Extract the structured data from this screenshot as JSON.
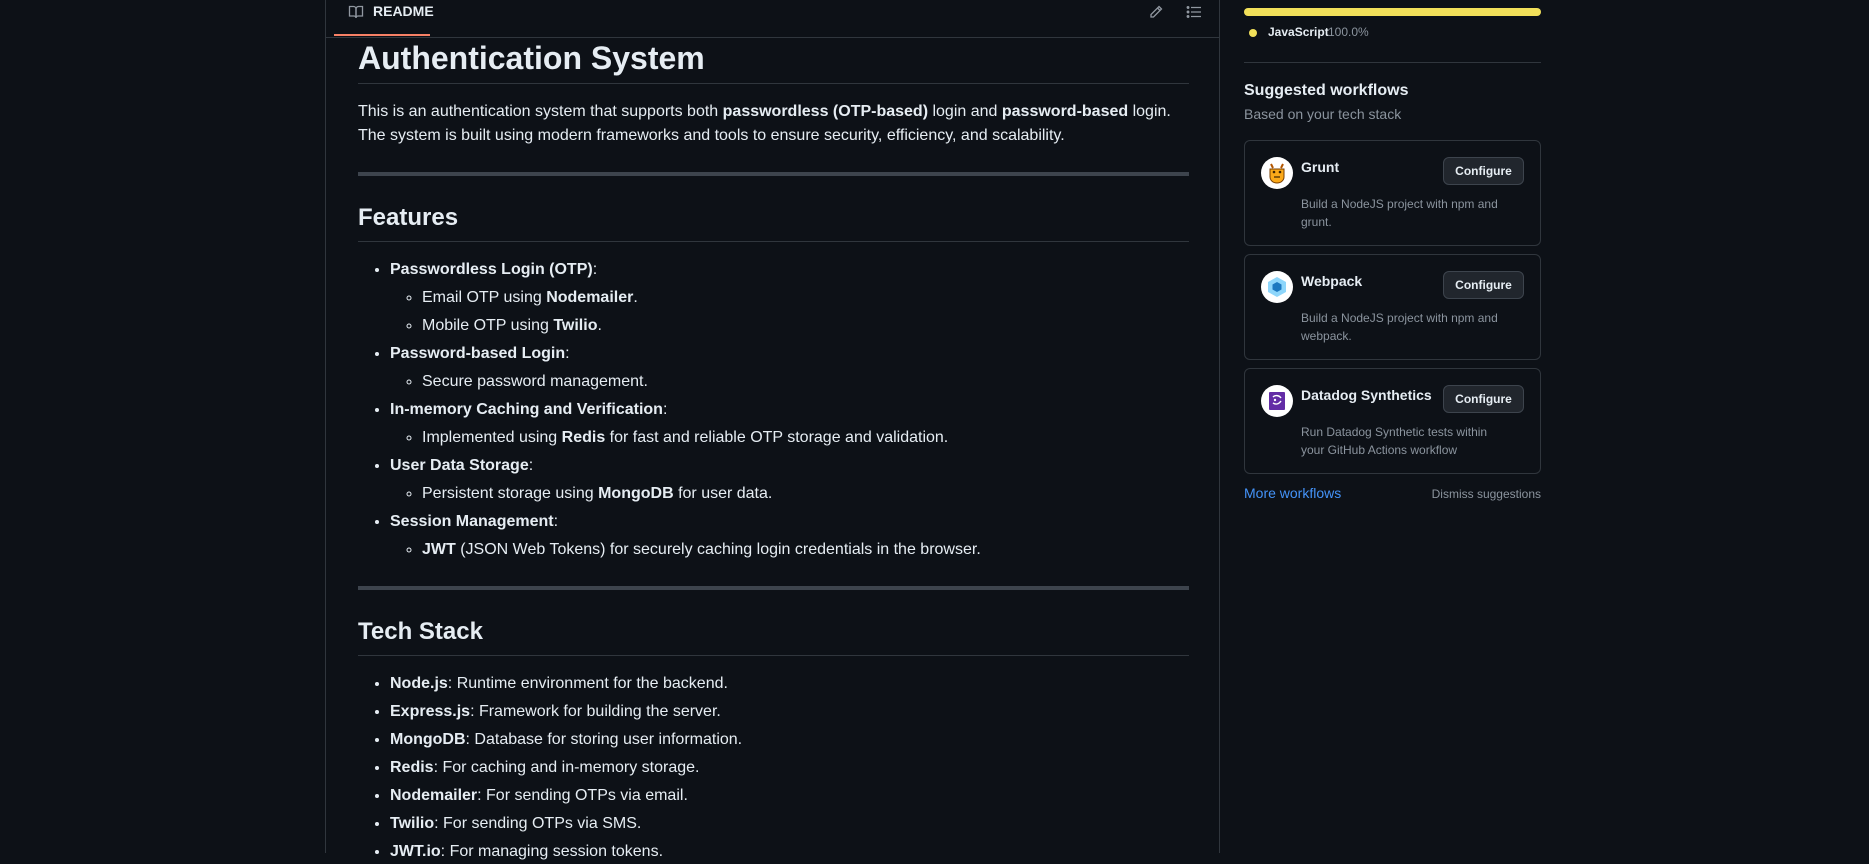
{
  "readme": {
    "tab_label": "README",
    "icons": {
      "tab": "book-icon",
      "edit": "pencil-icon",
      "outline": "list-icon"
    }
  },
  "content": {
    "title": "Authentication System",
    "intro": {
      "t1": "This is an authentication system that supports both ",
      "b1": "passwordless (OTP-based)",
      "t2": " login and ",
      "b2": "password-based",
      "t3": " login. The system is built using modern frameworks and tools to ensure security, efficiency, and scalability."
    },
    "features": {
      "heading": "Features",
      "items": [
        {
          "label": "Passwordless Login (OTP)",
          "suffix": ":",
          "subs": [
            {
              "pre": "Email OTP using ",
              "bold": "Nodemailer",
              "post": "."
            },
            {
              "pre": "Mobile OTP using ",
              "bold": "Twilio",
              "post": "."
            }
          ]
        },
        {
          "label": "Password-based Login",
          "suffix": ":",
          "subs": [
            {
              "pre": "Secure password management.",
              "bold": "",
              "post": ""
            }
          ]
        },
        {
          "label": "In-memory Caching and Verification",
          "suffix": ":",
          "subs": [
            {
              "pre": "Implemented using ",
              "bold": "Redis",
              "post": " for fast and reliable OTP storage and validation."
            }
          ]
        },
        {
          "label": "User Data Storage",
          "suffix": ":",
          "subs": [
            {
              "pre": "Persistent storage using ",
              "bold": "MongoDB",
              "post": " for user data."
            }
          ]
        },
        {
          "label": "Session Management",
          "suffix": ":",
          "subs": [
            {
              "pre": "",
              "bold": "JWT",
              "post": " (JSON Web Tokens) for securely caching login credentials in the browser."
            }
          ]
        }
      ]
    },
    "tech_stack": {
      "heading": "Tech Stack",
      "items": [
        {
          "bold": "Node.js",
          "text": ": Runtime environment for the backend."
        },
        {
          "bold": "Express.js",
          "text": ": Framework for building the server."
        },
        {
          "bold": "MongoDB",
          "text": ": Database for storing user information."
        },
        {
          "bold": "Redis",
          "text": ": For caching and in-memory storage."
        },
        {
          "bold": "Nodemailer",
          "text": ": For sending OTPs via email."
        },
        {
          "bold": "Twilio",
          "text": ": For sending OTPs via SMS."
        },
        {
          "bold": "JWT.io",
          "text": ": For managing session tokens."
        }
      ]
    }
  },
  "sidebar": {
    "language": {
      "name": "JavaScript",
      "percent": "100.0%",
      "color": "#f1e05a",
      "share": 1.0
    },
    "suggested": {
      "title": "Suggested workflows",
      "subtitle": "Based on your tech stack",
      "workflows": [
        {
          "name": "Grunt",
          "description": "Build a NodeJS project with npm and grunt.",
          "button": "Configure",
          "icon": "grunt-logo-icon"
        },
        {
          "name": "Webpack",
          "description": "Build a NodeJS project with npm and webpack.",
          "button": "Configure",
          "icon": "webpack-logo-icon"
        },
        {
          "name": "Datadog Synthetics",
          "description": "Run Datadog Synthetic tests within your GitHub Actions workflow",
          "button": "Configure",
          "icon": "datadog-logo-icon"
        }
      ],
      "more_link": "More workflows",
      "dismiss_link": "Dismiss suggestions"
    }
  }
}
